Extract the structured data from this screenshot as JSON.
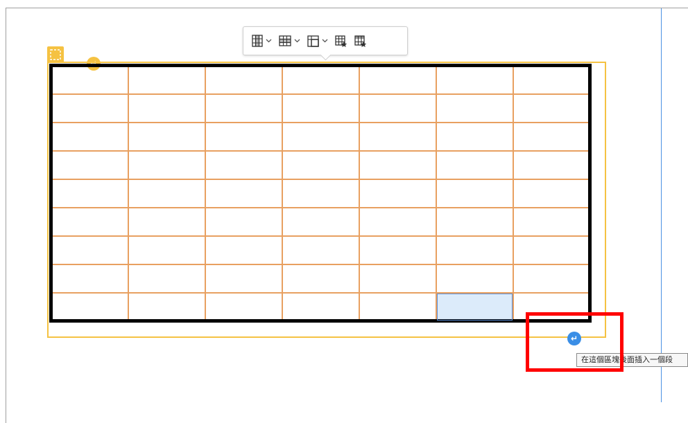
{
  "toolbar": {
    "items": [
      {
        "icon": "insert-column-icon",
        "has_dropdown": true
      },
      {
        "icon": "insert-row-icon",
        "has_dropdown": true
      },
      {
        "icon": "merge-cells-icon",
        "has_dropdown": true
      },
      {
        "icon": "table-properties-icon",
        "has_dropdown": false
      },
      {
        "icon": "cell-properties-icon",
        "has_dropdown": false
      }
    ]
  },
  "table": {
    "rows": 9,
    "columns": 7,
    "selected_cell": {
      "row": 9,
      "column": 6
    },
    "colors": {
      "outer_border": "#000000",
      "cell_border": "#e8a060",
      "widget_border": "#f5c242",
      "selected_fill": "#dcebfa"
    }
  },
  "insert_after": {
    "symbol": "↵"
  },
  "insert_before": {
    "symbol": "↵"
  },
  "tooltip": {
    "text": "在這個區塊後面插入一個段"
  },
  "colors": {
    "annotation": "#ff0000",
    "margin_line": "#4a90e2"
  }
}
